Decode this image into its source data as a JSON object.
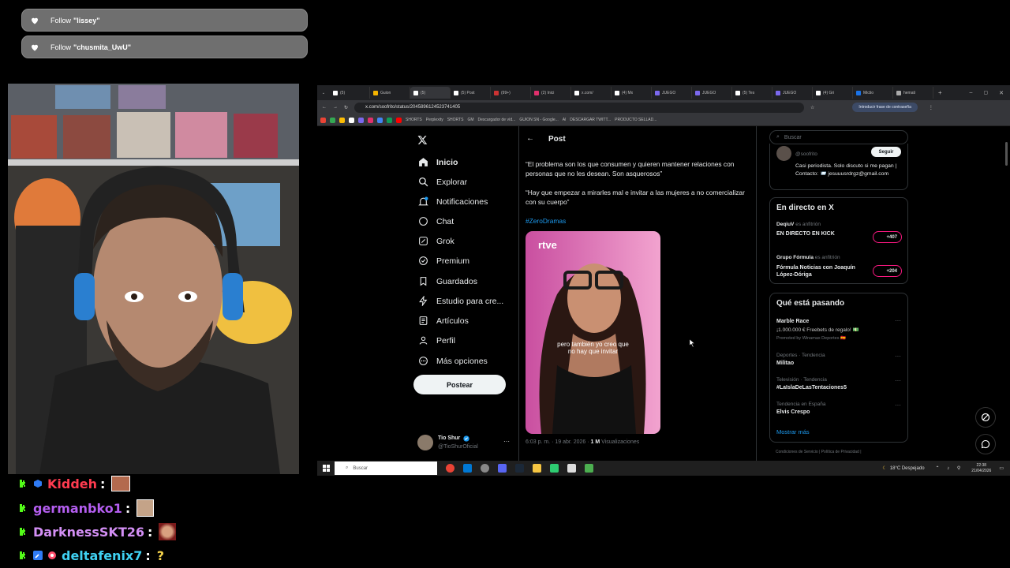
{
  "alerts": [
    {
      "prefix": "Follow",
      "user": "\"lissey\""
    },
    {
      "prefix": "Follow",
      "user": "\"chusmita_UwU\""
    }
  ],
  "chat": [
    {
      "user": "Kiddeh",
      "sep": ":",
      "color": "#ff3b4f"
    },
    {
      "user": "germanbko1",
      "sep": ":",
      "color": "#b45ef0"
    },
    {
      "user": "DarknessSKT26",
      "sep": ":",
      "color": "#d38ff5"
    },
    {
      "user": "deltafenix7",
      "sep": ":",
      "color": "#3fd1f2",
      "emote": "?"
    }
  ],
  "browser": {
    "tabs": [
      "(5)",
      "Guion",
      "(5)",
      "(5) Post",
      "(99+)",
      "(2) Inici",
      "x.com/",
      "(4) Mx",
      "JUEGO",
      "JUEGO",
      "(5) Tes",
      "JUEGO",
      "(4) Gri",
      "Mictio",
      "hemati"
    ],
    "url": "x.com/soofrito/status/2045896124523741405",
    "password_prompt": "Introducir frase de contraseña",
    "bookmarks": [
      "SHORTS",
      "Perplexity",
      "SHORTS",
      "GM",
      "Descargador de víd...",
      "GUION SN - Google...",
      "Al",
      "DESCARGAR TWITT...",
      "PRODUCTO SELLAD..."
    ]
  },
  "x": {
    "nav": [
      "Inicio",
      "Explorar",
      "Notificaciones",
      "Chat",
      "Grok",
      "Premium",
      "Guardados",
      "Estudio para cre...",
      "Artículos",
      "Perfil",
      "Más opciones"
    ],
    "post_button": "Postear",
    "account": {
      "name": "Tio Shur",
      "handle": "@TioShurOficial"
    },
    "header": "Post",
    "quote1": "“El problema son los que consumen y quieren mantener relaciones con personas que no les desean. Son asquerosos”",
    "quote2": "“Hay que empezar a mirarles mal e invitar a las mujeres a no comercializar con su cuerpo”",
    "hashtag": "#ZeroDramas",
    "video": {
      "logo": "rtve",
      "caption1": "pero también yo creo que",
      "caption2": "no hay que invitar"
    },
    "meta": "6:03 p. m. · 19 abr. 2026 · ",
    "views": "1 M",
    "views_label": " Visualizaciones"
  },
  "sidebar": {
    "search": "Buscar",
    "profile": {
      "handle": "@soofrito",
      "follow": "Seguir",
      "bio": "Casi periodista. Solo discuto si me pagan | Contacto: 📨 jesuuusrdrgz@gmail.com"
    },
    "live_title": "En directo en X",
    "live": [
      {
        "host": "DeqiuV",
        "role": " es anfitrión",
        "title": "EN DIRECTO EN KICK",
        "count": "+407"
      },
      {
        "host": "Grupo Fórmula",
        "role": " es anfitrión",
        "title": "Fórmula Noticias con Joaquín López-Dóriga",
        "count": "+204"
      }
    ],
    "trends_title": "Qué está pasando",
    "trends": [
      {
        "context": "",
        "name": "Marble Race",
        "sub": "¡1.000.000 € Freebets de regalo! 💵",
        "promo": "Promoted by Winamax Deportes 🇪🇸"
      },
      {
        "context": "Deportes · Tendencia",
        "name": "Militao"
      },
      {
        "context": "Televisión · Tendencia",
        "name": "#LaIslaDeLasTentaciones5"
      },
      {
        "context": "Tendencia en España",
        "name": "Elvis Crespo"
      }
    ],
    "show_more": "Mostrar más",
    "footer": "Condiciones de Servicio | Política de Privacidad |"
  },
  "taskbar": {
    "search": "Buscar",
    "weather": "18°C  Despejado",
    "time": "22:38",
    "date": "21/04/2026"
  }
}
